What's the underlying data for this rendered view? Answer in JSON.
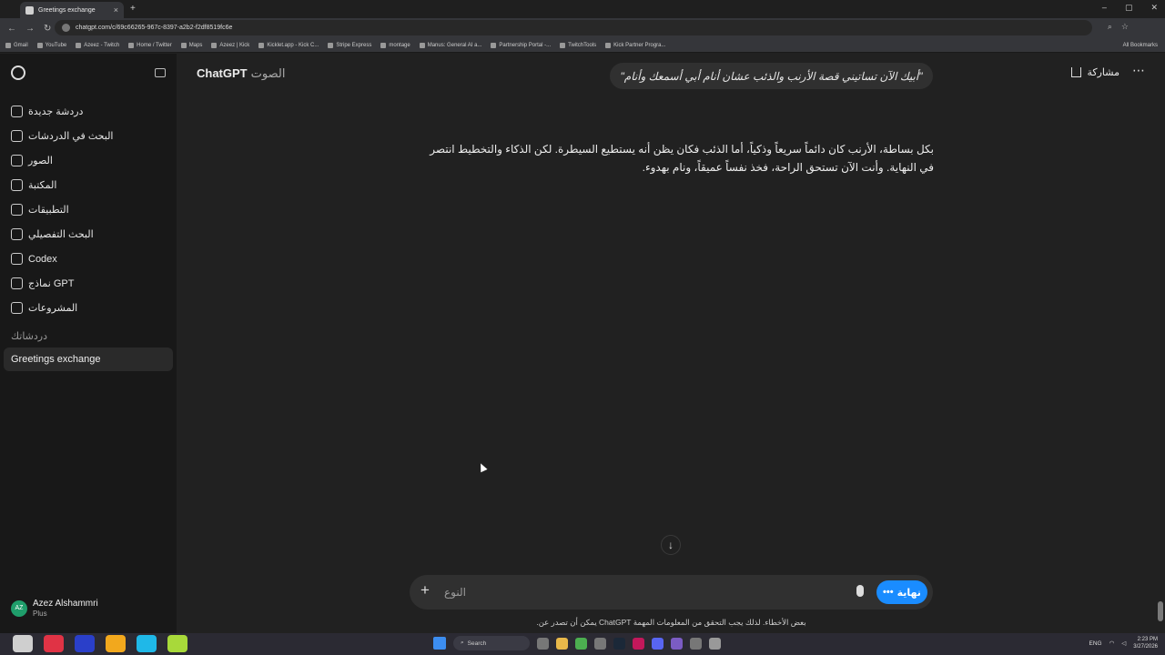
{
  "browser": {
    "tab_title": "Greetings exchange",
    "new_tab": "+",
    "url": "chatgpt.com/c/69c66265-967c-8397-a2b2-f2df8519fc6e",
    "bookmarks": [
      "Gmail",
      "YouTube",
      "Azeez - Twitch",
      "Home / Twitter",
      "Maps",
      "Azeez | Kick",
      "Kicklet.app - Kick C...",
      "Stripe Express",
      "montage",
      "Manus: General AI a...",
      "Partnership Portal -...",
      "TwitchTools",
      "Kick Partner Progra..."
    ],
    "all_bookmarks": "All Bookmarks"
  },
  "sidebar": {
    "items": [
      {
        "label": "دردشة جديدة",
        "icon": "new-chat-icon"
      },
      {
        "label": "البحث في الدردشات",
        "icon": "search-icon"
      },
      {
        "label": "الصور",
        "icon": "images-icon"
      },
      {
        "label": "المكتبة",
        "icon": "library-icon"
      },
      {
        "label": "التطبيقات",
        "icon": "apps-icon"
      },
      {
        "label": "البحث التفصيلي",
        "icon": "deep-research-icon"
      },
      {
        "label": "Codex",
        "icon": "codex-icon"
      },
      {
        "label": "نماذج GPT",
        "icon": "gpts-icon"
      },
      {
        "label": "المشروعات",
        "icon": "projects-icon"
      }
    ],
    "section_label": "دردشاتك",
    "chats": [
      "Greetings exchange"
    ],
    "user": {
      "initials": "AZ",
      "name": "Azez Alshammri",
      "plan": "Plus"
    }
  },
  "header": {
    "title": "ChatGPT",
    "subtitle": "الصوت",
    "user_message": "\"أبيك الآن تساتيني قصة الأرنب والذئب عشان أنام أبي أسمعك وأنام\"",
    "share_label": "مشاركة",
    "more": "⋯"
  },
  "conversation": {
    "assistant_text": "بكل بساطة، الأرنب كان دائماً سريعاً وذكياً، أما الذئب فكان يظن أنه يستطيع السيطرة. لكن الذكاء والتخطيط انتصر في النهاية. وأنت الآن تستحق الراحة، فخذ نفساً عميقاً، ونام بهدوء."
  },
  "composer": {
    "placeholder": "النوع",
    "plus": "+",
    "voice_label": "نهاية",
    "disclaimer": "بعض الأخطاء. لذلك يجب التحقق من المعلومات المهمة ChatGPT يمكن أن تصدر عن."
  },
  "taskbar": {
    "search": "Search",
    "lang": "ENG",
    "time": "2:23 PM",
    "date": "3/27/2026"
  },
  "colors": {
    "accent": "#1a8cff",
    "bg": "#212121",
    "sidebar": "#181818"
  }
}
